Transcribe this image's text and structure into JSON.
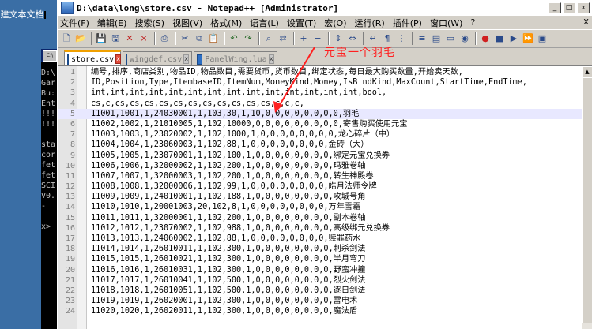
{
  "desktop": {
    "icon_label": "建文本文档"
  },
  "console": {
    "lines": [
      "D:\\",
      "Gar",
      "Bu:",
      "Ent",
      "!!!",
      "!!!",
      "",
      "sta",
      "cor",
      "fet",
      "fet",
      "SCI",
      "V0.",
      "-",
      "",
      "x>"
    ]
  },
  "window": {
    "title": "D:\\data\\long\\store.csv - Notepad++ [Administrator]",
    "controls": {
      "minimize": "_",
      "maximize": "□",
      "close": "x"
    }
  },
  "menu": {
    "items": [
      "文件(F)",
      "编辑(E)",
      "搜索(S)",
      "视图(V)",
      "格式(M)",
      "语言(L)",
      "设置(T)",
      "宏(O)",
      "运行(R)",
      "插件(P)",
      "窗口(W)",
      "?"
    ],
    "close_doc": "X"
  },
  "toolbar": {
    "icons": [
      "new-file-icon",
      "open-file-icon",
      "save-icon",
      "save-all-icon",
      "close-file-icon",
      "close-all-icon",
      "print-icon",
      "cut-icon",
      "copy-icon",
      "paste-icon",
      "undo-icon",
      "redo-icon",
      "find-icon",
      "replace-icon",
      "zoom-in-icon",
      "zoom-out-icon",
      "sync-v-icon",
      "sync-h-icon",
      "word-wrap-icon",
      "show-all-icon",
      "indent-guide-icon",
      "lang-icon",
      "doc-map-icon",
      "folder-icon",
      "monitor-icon",
      "record-macro-icon",
      "stop-macro-icon",
      "play-macro-icon",
      "run-macro-icon",
      "save-macro-icon"
    ]
  },
  "tabs": [
    {
      "label": "store.csv",
      "active": true
    },
    {
      "label": "wingdef.csv",
      "active": false
    },
    {
      "label": "PanelWing.lua",
      "active": false
    }
  ],
  "annotation": {
    "text": "元宝一个羽毛",
    "color": "#ff2020"
  },
  "editor": {
    "current_line": 5,
    "lines": [
      {
        "n": "1",
        "text": "编号,排序,商店类别,物品ID,物品数目,需要货币,货币数目,绑定状态,每日最大购买数量,开始卖天数,"
      },
      {
        "n": "2",
        "text": "ID,Position,Type,ItembaseID,ItemNum,MoneyKind,Money,IsBindKind,MaxCount,StartTime,EndTime,"
      },
      {
        "n": "3",
        "text": "int,int,int,int,int,int,int,int,int,int,int,int,int,int,bool,"
      },
      {
        "n": "4",
        "text": "cs,c,cs,cs,cs,cs,cs,cs,cs,cs,cs,cs,cs,c,c,c,"
      },
      {
        "n": "5",
        "text": "11001,1001,1,24030001,1,103,30,1,10,0,0,0,0,0,0,0,0,羽毛"
      },
      {
        "n": "6",
        "text": "11002,1002,1,21010005,1,102,10000,0,0,0,0,0,0,0,0,0,寄售购买使用元宝"
      },
      {
        "n": "7",
        "text": "11003,1003,1,23020002,1,102,1000,1,0,0,0,0,0,0,0,0,龙心碎片（中）"
      },
      {
        "n": "8",
        "text": "11004,1004,1,23060003,1,102,88,1,0,0,0,0,0,0,0,0,金砖（大）"
      },
      {
        "n": "9",
        "text": "11005,1005,1,23070001,1,102,100,1,0,0,0,0,0,0,0,0,绑定元宝兑换券"
      },
      {
        "n": "10",
        "text": "11006,1006,1,32000002,1,102,200,1,0,0,0,0,0,0,0,0,玛雅卷轴"
      },
      {
        "n": "11",
        "text": "11007,1007,1,32000003,1,102,200,1,0,0,0,0,0,0,0,0,转生神殿卷"
      },
      {
        "n": "12",
        "text": "11008,1008,1,32000006,1,102,99,1,0,0,0,0,0,0,0,0,皓月法师令牌"
      },
      {
        "n": "13",
        "text": "11009,1009,1,24010001,1,102,188,1,0,0,0,0,0,0,0,0,攻城号角"
      },
      {
        "n": "14",
        "text": "11010,1010,1,20001003,20,102,8,1,0,0,0,0,0,0,0,0,万年雪霜"
      },
      {
        "n": "15",
        "text": "11011,1011,1,32000001,1,102,200,1,0,0,0,0,0,0,0,0,副本卷轴"
      },
      {
        "n": "16",
        "text": "11012,1012,1,23070002,1,102,988,1,0,0,0,0,0,0,0,0,高级绑元兑换券"
      },
      {
        "n": "17",
        "text": "11013,1013,1,24060002,1,102,88,1,0,0,0,0,0,0,0,0,赎罪药水"
      },
      {
        "n": "18",
        "text": "11014,1014,1,26010011,1,102,300,1,0,0,0,0,0,0,0,0,刺杀剑法"
      },
      {
        "n": "19",
        "text": "11015,1015,1,26010021,1,102,300,1,0,0,0,0,0,0,0,0,半月弯刀"
      },
      {
        "n": "20",
        "text": "11016,1016,1,26010031,1,102,300,1,0,0,0,0,0,0,0,0,野蛮冲撞"
      },
      {
        "n": "21",
        "text": "11017,1017,1,26010041,1,102,500,1,0,0,0,0,0,0,0,0,烈火剑法"
      },
      {
        "n": "22",
        "text": "11018,1018,1,26010051,1,102,500,1,0,0,0,0,0,0,0,0,逐日剑法"
      },
      {
        "n": "23",
        "text": "11019,1019,1,26020001,1,102,300,1,0,0,0,0,0,0,0,0,雷电术"
      },
      {
        "n": "24",
        "text": "11020,1020,1,26020011,1,102,300,1,0,0,0,0,0,0,0,0,魔法盾"
      }
    ]
  }
}
